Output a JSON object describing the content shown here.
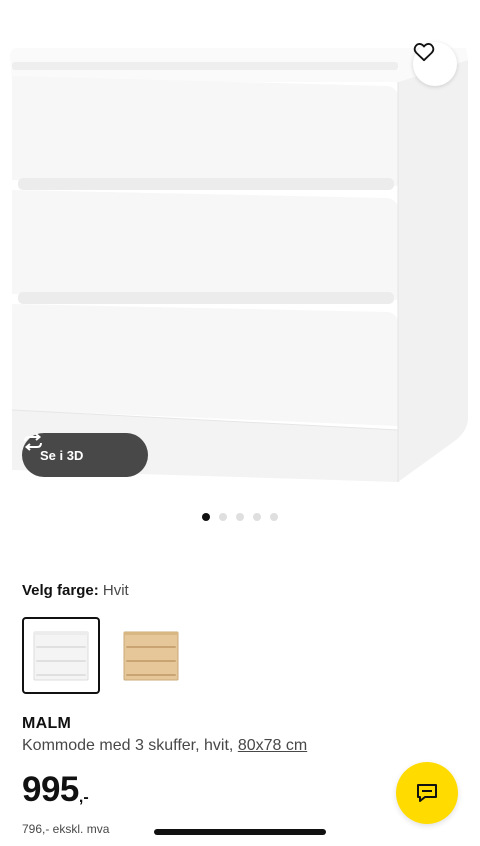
{
  "product": {
    "name": "MALM",
    "description": "Kommode med 3 skuffer, hvit,",
    "dimensions": "80x78 cm",
    "price_int": "995",
    "price_suffix": ",-",
    "price_excl": "796,- ekskl. mva"
  },
  "gallery": {
    "view3d_label": "Se i 3D",
    "dot_count": 5,
    "active_dot": 1
  },
  "color_select": {
    "label": "Velg farge:",
    "value": "Hvit",
    "swatches": [
      {
        "name": "white",
        "selected": true
      },
      {
        "name": "white-stained-oak",
        "selected": false
      }
    ]
  },
  "colors": {
    "accent_yellow": "#ffdb00",
    "text_dark": "#111111",
    "text_muted": "#484848",
    "pill_bg": "#484848"
  },
  "icons": [
    "heart-icon",
    "rotate-3d-icon",
    "chat-icon"
  ]
}
